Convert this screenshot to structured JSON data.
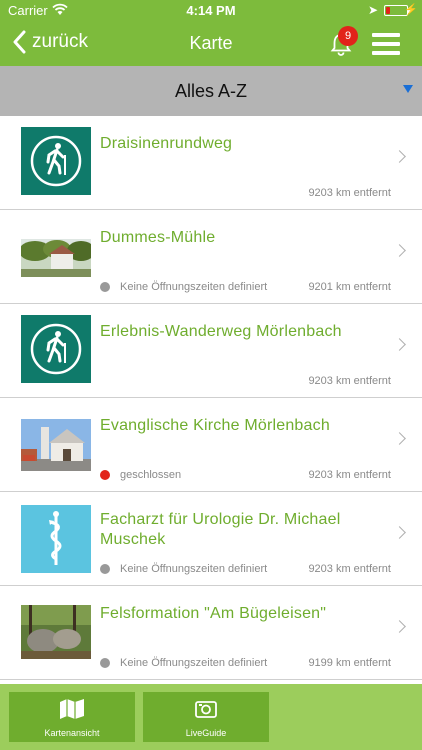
{
  "status_bar": {
    "carrier": "Carrier",
    "time": "4:14 PM"
  },
  "nav": {
    "back_label": "zurück",
    "title": "Karte",
    "notification_count": "9"
  },
  "filter": {
    "label": "Alles A-Z"
  },
  "colors": {
    "brand_green": "#7dbb3c",
    "title_green": "#6fad2e",
    "closed_red": "#e2231a",
    "undefined_gray": "#999999",
    "hike_teal": "#0f7a6a",
    "medical_blue": "#5bc4e0"
  },
  "items": [
    {
      "name": "Draisinenrundweg",
      "status": "",
      "distance": "9203 km entfernt",
      "image": "hiking-icon"
    },
    {
      "name": "Dummes-Mühle",
      "status": "Keine Öffnungszeiten definiert",
      "distance": "9201 km entfernt",
      "image": "mill-photo"
    },
    {
      "name": "Erlebnis-Wanderweg Mörlenbach",
      "status": "",
      "distance": "9203 km entfernt",
      "image": "hiking-icon"
    },
    {
      "name": "Evanglische Kirche Mörlenbach",
      "status": "geschlossen",
      "distance": "9203 km entfernt",
      "image": "church-photo"
    },
    {
      "name": "Facharzt für Urologie Dr. Michael Muschek",
      "status": "Keine Öffnungszeiten definiert",
      "distance": "9203 km entfernt",
      "image": "medical-icon"
    },
    {
      "name": "Felsformation \"Am Bügeleisen\"",
      "status": "Keine Öffnungszeiten definiert",
      "distance": "9199 km entfernt",
      "image": "rock-photo"
    }
  ],
  "tabs": [
    {
      "label": "Kartenansicht",
      "icon": "map-icon"
    },
    {
      "label": "LiveGuide",
      "icon": "camera-icon"
    }
  ]
}
